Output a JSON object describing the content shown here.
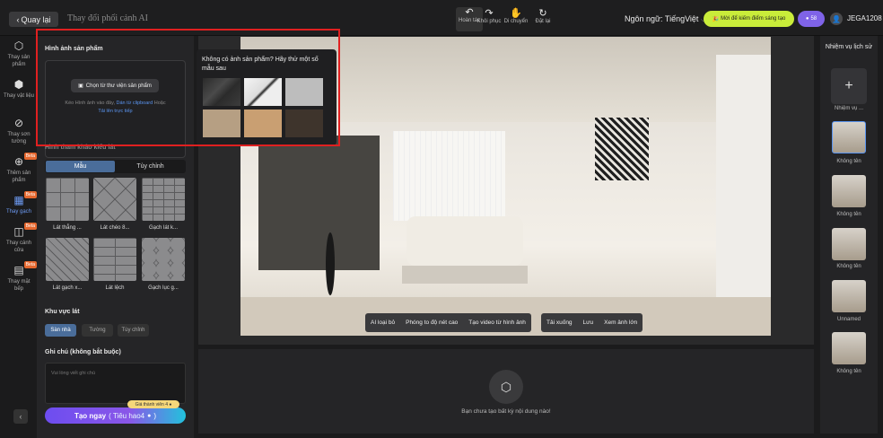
{
  "header": {
    "back_label": "Quay lại",
    "title": "Thay đổi phối cảnh AI",
    "tools": [
      {
        "label": "Hoàn tác",
        "icon": "undo-icon"
      },
      {
        "label": "Khôi phục",
        "icon": "redo-icon"
      },
      {
        "label": "Di chuyển",
        "icon": "hand-icon"
      },
      {
        "label": "Đặt lại",
        "icon": "reset-icon"
      }
    ],
    "language_label": "Ngôn ngữ:",
    "language_value": "TiếngViệt",
    "promo_label": "Mời để kiếm điểm sáng tạo",
    "coins": "58",
    "username": "JEGA1208"
  },
  "rail": {
    "items": [
      {
        "label": "Thay sản phẩm",
        "icon": "cube-icon",
        "beta": false
      },
      {
        "label": "Thay vật liệu",
        "icon": "material-icon",
        "beta": false
      },
      {
        "label": "Thay sơn tường",
        "icon": "paint-icon",
        "beta": false
      },
      {
        "label": "Thêm sản phẩm",
        "icon": "add-product-icon",
        "beta": true
      },
      {
        "label": "Thay gạch",
        "icon": "tile-icon",
        "beta": true
      },
      {
        "label": "Thay cánh cửa",
        "icon": "door-icon",
        "beta": true
      },
      {
        "label": "Thay mặt bếp",
        "icon": "kitchen-icon",
        "beta": true
      }
    ],
    "beta_label": "Beta"
  },
  "panel": {
    "product_image_title": "Hình ảnh sản phẩm",
    "library_button": "Chọn từ thư viện sản phẩm",
    "drop_hint_prefix": "Kéo Hình ảnh vào đây,",
    "paste_link": "Dán từ clipboard",
    "or_text": "Hoặc",
    "upload_link": "Tải lên trực tiếp",
    "reference_title": "Hình tham khảo kiểu lát",
    "mode_tabs": [
      "Mẫu",
      "Tùy chỉnh"
    ],
    "patterns": [
      "Lát thẳng ...",
      "Lát chéo 8...",
      "Gạch lát k...",
      "Lát gạch x...",
      "Lát lệch",
      "Gạch lục g..."
    ],
    "area_title": "Khu vực lát",
    "areas": [
      "Sàn nhà",
      "Tường",
      "Tùy chỉnh"
    ],
    "notes_title": "Ghi chú (không bắt buộc)",
    "notes_placeholder": "Vui lòng viết ghi chú",
    "member_price": "Giá thành viên 4",
    "generate_label": "Tạo ngay",
    "generate_cost": "( Tiêu hao4",
    "generate_cost_end": ")"
  },
  "popover": {
    "title": "Không có ảnh sản phẩm? Hãy thử một số mẫu sau"
  },
  "canvas_actions": {
    "group1": [
      "AI loại bỏ",
      "Phóng to độ nét cao",
      "Tạo video từ hình ảnh"
    ],
    "group2": [
      "Tải xuống",
      "Lưu",
      "Xem ảnh lớn"
    ]
  },
  "results": {
    "empty_text": "Bạn chưa tạo bất kỳ nội dung nào!"
  },
  "history": {
    "title": "Nhiệm vụ lịch sử",
    "new_task_label": "Nhiệm vụ ...",
    "items": [
      "Không tên",
      "Không tên",
      "Không tên",
      "Unnamed",
      "Không tên"
    ]
  },
  "colors": {
    "accent": "#5a94ef",
    "highlight": "#e02020",
    "promo": "#c9ec3a"
  }
}
